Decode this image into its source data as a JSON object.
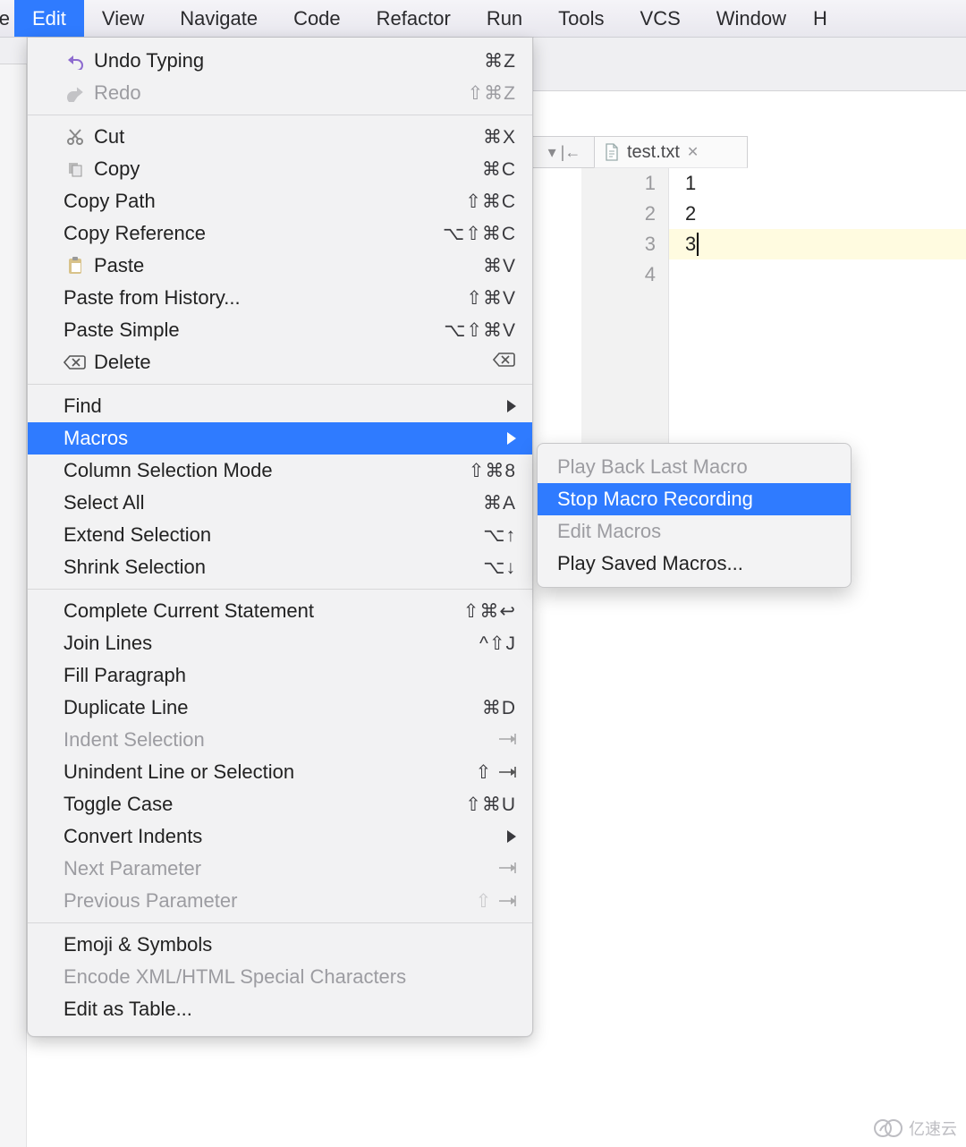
{
  "menubar": {
    "leading_fragment": "e",
    "trailing_fragment": "H",
    "items": [
      {
        "label": "Edit",
        "active": true
      },
      {
        "label": "View"
      },
      {
        "label": "Navigate"
      },
      {
        "label": "Code"
      },
      {
        "label": "Refactor"
      },
      {
        "label": "Run"
      },
      {
        "label": "Tools"
      },
      {
        "label": "VCS"
      },
      {
        "label": "Window"
      }
    ]
  },
  "edit_menu": {
    "groups": [
      [
        {
          "label": "Undo Typing",
          "shortcut": "⌘Z",
          "icon": "undo-icon"
        },
        {
          "label": "Redo",
          "shortcut": "⇧⌘Z",
          "icon": "redo-icon",
          "disabled": true
        }
      ],
      [
        {
          "label": "Cut",
          "shortcut": "⌘X",
          "icon": "cut-icon"
        },
        {
          "label": "Copy",
          "shortcut": "⌘C",
          "icon": "copy-icon"
        },
        {
          "label": "Copy Path",
          "shortcut": "⇧⌘C"
        },
        {
          "label": "Copy Reference",
          "shortcut": "⌥⇧⌘C"
        },
        {
          "label": "Paste",
          "shortcut": "⌘V",
          "icon": "paste-icon"
        },
        {
          "label": "Paste from History...",
          "shortcut": "⇧⌘V"
        },
        {
          "label": "Paste Simple",
          "shortcut": "⌥⇧⌘V"
        },
        {
          "label": "Delete",
          "shortcut": "",
          "icon": "delete-key-icon",
          "shortcut_icon": true
        }
      ],
      [
        {
          "label": "Find",
          "submenu": true
        },
        {
          "label": "Macros",
          "submenu": true,
          "highlight": true
        },
        {
          "label": "Column Selection Mode",
          "shortcut": "⇧⌘8"
        },
        {
          "label": "Select All",
          "shortcut": "⌘A"
        },
        {
          "label": "Extend Selection",
          "shortcut": "⌥↑"
        },
        {
          "label": "Shrink Selection",
          "shortcut": "⌥↓"
        }
      ],
      [
        {
          "label": "Complete Current Statement",
          "shortcut": "⇧⌘↩"
        },
        {
          "label": "Join Lines",
          "shortcut": "^⇧J"
        },
        {
          "label": "Fill Paragraph"
        },
        {
          "label": "Duplicate Line",
          "shortcut": "⌘D"
        },
        {
          "label": "Indent Selection",
          "shortcut": "→|",
          "disabled": true
        },
        {
          "label": "Unindent Line or Selection",
          "shortcut": "⇧→|"
        },
        {
          "label": "Toggle Case",
          "shortcut": "⇧⌘U"
        },
        {
          "label": "Convert Indents",
          "submenu": true
        },
        {
          "label": "Next Parameter",
          "shortcut": "→|",
          "disabled": true
        },
        {
          "label": "Previous Parameter",
          "shortcut": "⇧→|",
          "disabled": true
        }
      ],
      [
        {
          "label": "Emoji & Symbols"
        },
        {
          "label": "Encode XML/HTML Special Characters",
          "disabled": true
        },
        {
          "label": "Edit as Table..."
        }
      ]
    ]
  },
  "macros_submenu": {
    "items": [
      {
        "label": "Play Back Last Macro",
        "disabled": true
      },
      {
        "label": "Stop Macro Recording",
        "highlight": true
      },
      {
        "label": "Edit Macros",
        "disabled": true
      },
      {
        "label": "Play Saved Macros..."
      }
    ]
  },
  "editor": {
    "tab_label": "test.txt",
    "gutter": [
      "1",
      "2",
      "3",
      "4"
    ],
    "lines": [
      "1",
      "2",
      "3",
      ""
    ],
    "caret_line": 3
  },
  "watermark": "亿速云"
}
